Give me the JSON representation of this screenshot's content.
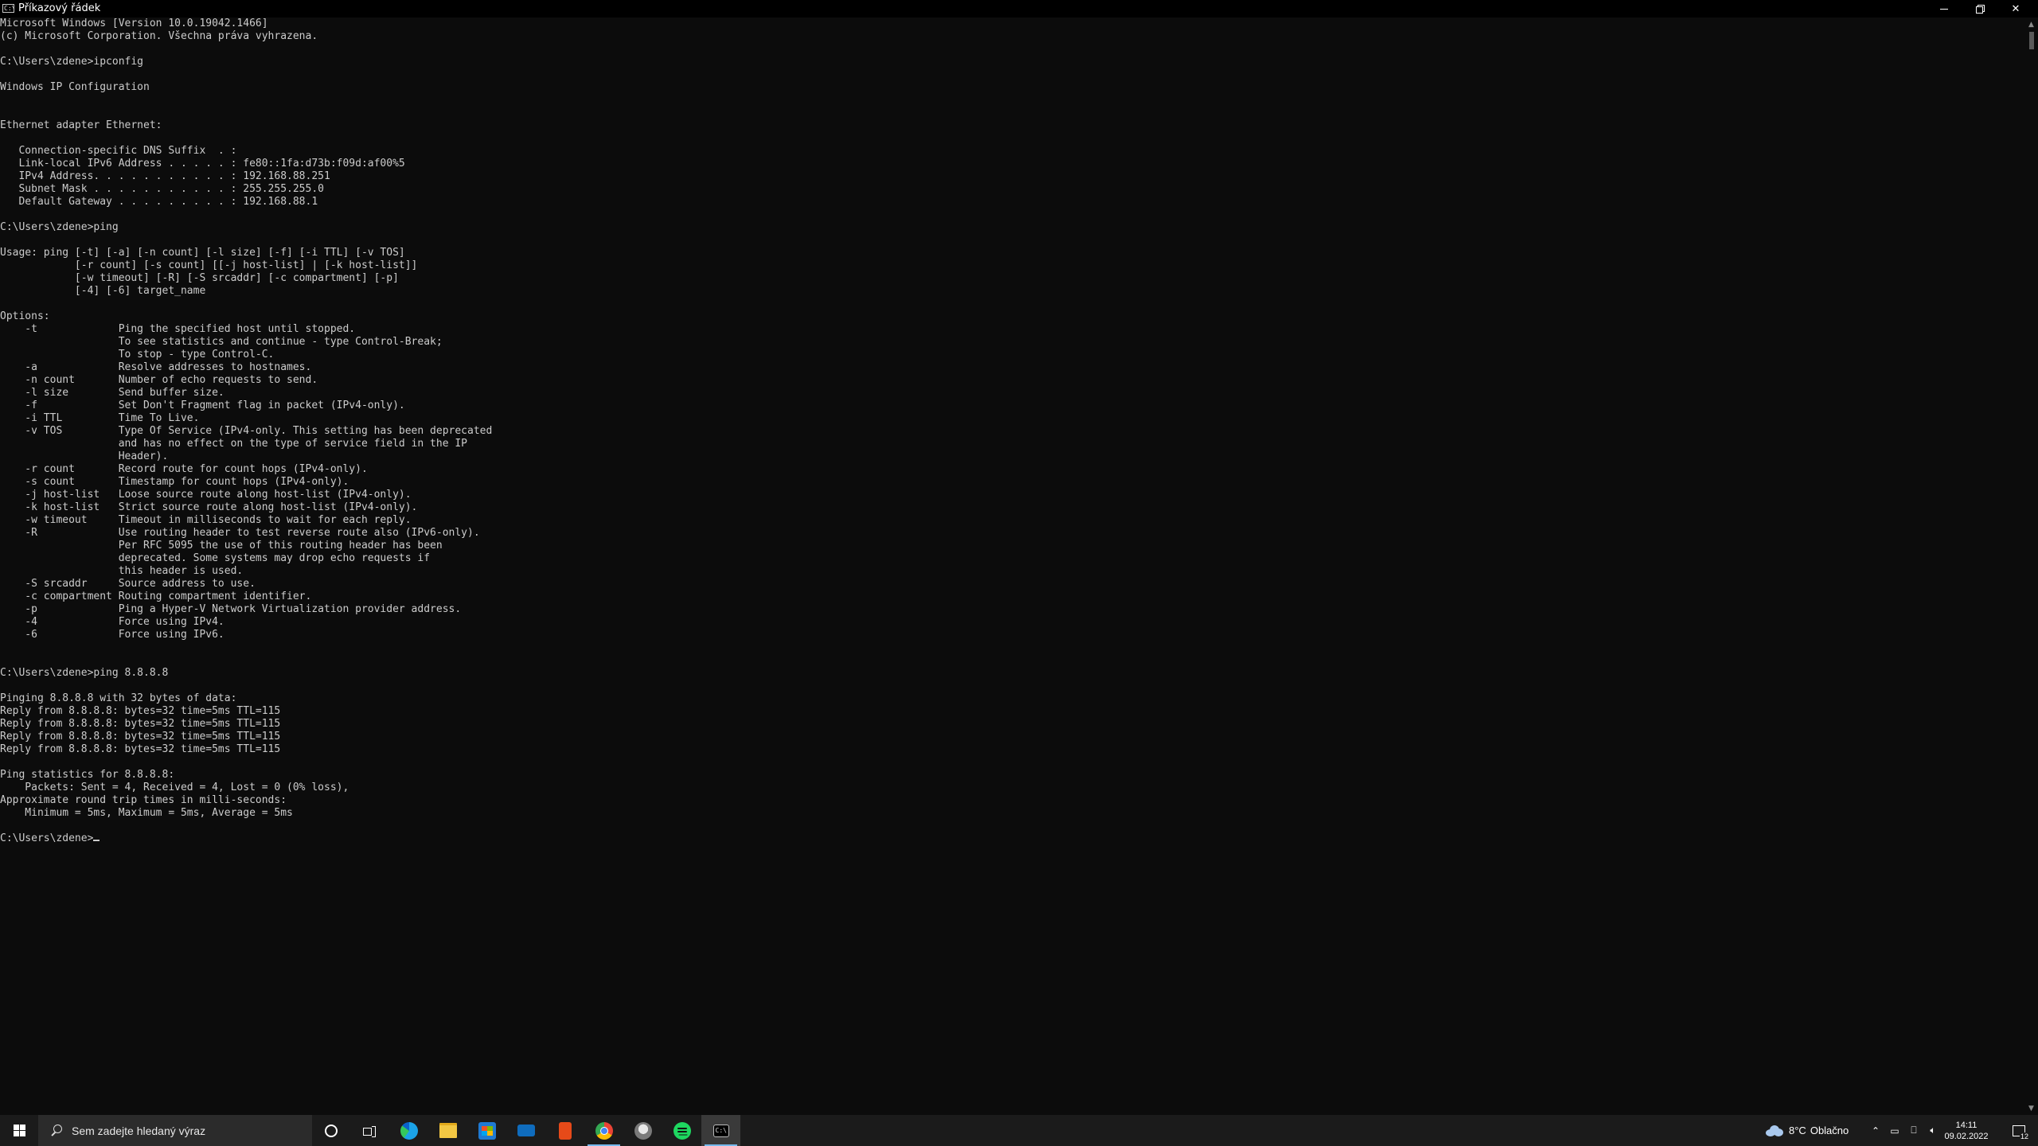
{
  "window": {
    "title": "Příkazový řádek",
    "icon_text": "C:\\"
  },
  "console": {
    "lines": [
      "Microsoft Windows [Version 10.0.19042.1466]",
      "(c) Microsoft Corporation. Všechna práva vyhrazena.",
      "",
      "C:\\Users\\zdene>ipconfig",
      "",
      "Windows IP Configuration",
      "",
      "",
      "Ethernet adapter Ethernet:",
      "",
      "   Connection-specific DNS Suffix  . :",
      "   Link-local IPv6 Address . . . . . : fe80::1fa:d73b:f09d:af00%5",
      "   IPv4 Address. . . . . . . . . . . : 192.168.88.251",
      "   Subnet Mask . . . . . . . . . . . : 255.255.255.0",
      "   Default Gateway . . . . . . . . . : 192.168.88.1",
      "",
      "C:\\Users\\zdene>ping",
      "",
      "Usage: ping [-t] [-a] [-n count] [-l size] [-f] [-i TTL] [-v TOS]",
      "            [-r count] [-s count] [[-j host-list] | [-k host-list]]",
      "            [-w timeout] [-R] [-S srcaddr] [-c compartment] [-p]",
      "            [-4] [-6] target_name",
      "",
      "Options:",
      "    -t             Ping the specified host until stopped.",
      "                   To see statistics and continue - type Control-Break;",
      "                   To stop - type Control-C.",
      "    -a             Resolve addresses to hostnames.",
      "    -n count       Number of echo requests to send.",
      "    -l size        Send buffer size.",
      "    -f             Set Don't Fragment flag in packet (IPv4-only).",
      "    -i TTL         Time To Live.",
      "    -v TOS         Type Of Service (IPv4-only. This setting has been deprecated",
      "                   and has no effect on the type of service field in the IP",
      "                   Header).",
      "    -r count       Record route for count hops (IPv4-only).",
      "    -s count       Timestamp for count hops (IPv4-only).",
      "    -j host-list   Loose source route along host-list (IPv4-only).",
      "    -k host-list   Strict source route along host-list (IPv4-only).",
      "    -w timeout     Timeout in milliseconds to wait for each reply.",
      "    -R             Use routing header to test reverse route also (IPv6-only).",
      "                   Per RFC 5095 the use of this routing header has been",
      "                   deprecated. Some systems may drop echo requests if",
      "                   this header is used.",
      "    -S srcaddr     Source address to use.",
      "    -c compartment Routing compartment identifier.",
      "    -p             Ping a Hyper-V Network Virtualization provider address.",
      "    -4             Force using IPv4.",
      "    -6             Force using IPv6.",
      "",
      "",
      "C:\\Users\\zdene>ping 8.8.8.8",
      "",
      "Pinging 8.8.8.8 with 32 bytes of data:",
      "Reply from 8.8.8.8: bytes=32 time=5ms TTL=115",
      "Reply from 8.8.8.8: bytes=32 time=5ms TTL=115",
      "Reply from 8.8.8.8: bytes=32 time=5ms TTL=115",
      "Reply from 8.8.8.8: bytes=32 time=5ms TTL=115",
      "",
      "Ping statistics for 8.8.8.8:",
      "    Packets: Sent = 4, Received = 4, Lost = 0 (0% loss),",
      "Approximate round trip times in milli-seconds:",
      "    Minimum = 5ms, Maximum = 5ms, Average = 5ms",
      ""
    ],
    "prompt": "C:\\Users\\zdene>",
    "text_color": "#cccccc",
    "background_color": "#0c0c0c"
  },
  "taskbar": {
    "search_placeholder": "Sem zadejte hledaný výraz",
    "pinned_apps": [
      "edge-icon",
      "file-explorer-icon",
      "microsoft-store-icon",
      "mail-icon",
      "office-icon",
      "chrome-icon",
      "linux-icon",
      "spotify-icon",
      "command-prompt-icon"
    ],
    "active_app": "command-prompt-icon",
    "weather": {
      "temperature": "8°C",
      "condition": "Oblačno"
    },
    "clock": {
      "time": "14:11",
      "date": "09.02.2022"
    },
    "notification_count": "12",
    "background_color": "#1b1b1b",
    "accent_color": "#76b9ed"
  }
}
